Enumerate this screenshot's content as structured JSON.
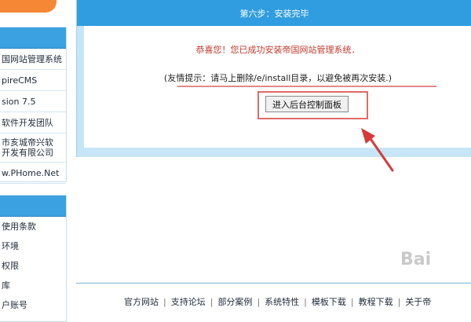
{
  "sidebar": {
    "box1_items": [
      "国网站管理系统",
      "pireCMS",
      "sion 7.5",
      "软件开发团队",
      "市亥城帝兴软\n开发有限公司",
      "w.PHome.Net"
    ],
    "box2_items": [
      "使用条款",
      "环境",
      "权限",
      "库",
      "户账号"
    ]
  },
  "main": {
    "step_title": "第六步：安装完毕",
    "success_message": "恭喜您！您已成功安装帝国网站管理系统．",
    "tip_message": "(友情提示：请马上删除/e/install目录，以避免被再次安装.)",
    "enter_button_label": "进入后台控制面板"
  },
  "footer": {
    "links": [
      "官方网站",
      "支持论坛",
      "部分案例",
      "系统特性",
      "模板下载",
      "教程下载",
      "关于帝"
    ],
    "separator": "|"
  },
  "watermark": {
    "text": "Bai"
  },
  "colors": {
    "header_blue": "#2f9de0",
    "panel_light_blue": "#c6e6f7",
    "success_red": "#c0392b",
    "highlight_red": "#e06a6a",
    "orange": "#f47a1f"
  }
}
